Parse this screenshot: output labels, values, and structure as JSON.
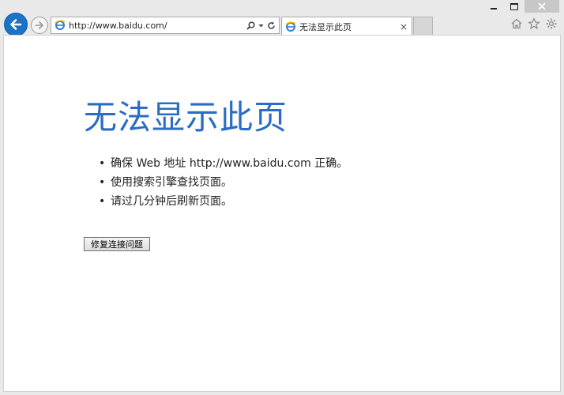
{
  "browser": {
    "address_url": "http://www.baidu.com/",
    "tab_title": "无法显示此页",
    "tab_close": "×"
  },
  "page": {
    "heading": "无法显示此页",
    "tips": [
      "确保 Web 地址 http://www.baidu.com 正确。",
      "使用搜索引擎查找页面。",
      "请过几分钟后刷新页面。"
    ],
    "fix_button_label": "修复连接问题"
  },
  "icons": {
    "back": "back-arrow-icon",
    "forward": "forward-arrow-icon",
    "site": "ie-logo-icon",
    "search": "search-icon",
    "dropdown": "chevron-down-icon",
    "refresh": "refresh-icon",
    "home": "home-icon",
    "favorites": "star-icon",
    "tools": "gear-icon"
  },
  "colors": {
    "accent": "#1a73c6",
    "heading": "#2b6cc4"
  }
}
